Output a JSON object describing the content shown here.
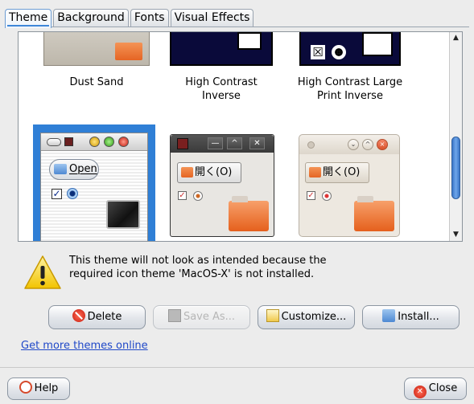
{
  "tabs": [
    {
      "label": "Theme",
      "active": true
    },
    {
      "label": "Background",
      "active": false
    },
    {
      "label": "Fonts",
      "active": false
    },
    {
      "label": "Visual Effects",
      "active": false
    }
  ],
  "themes": {
    "dust_sand": {
      "label": "Dust Sand"
    },
    "high_contrast_inverse": {
      "label_line1": "High Contrast",
      "label_line2": "Inverse"
    },
    "high_contrast_large_print_inverse": {
      "label_line1": "High Contrast Large",
      "label_line2": "Print Inverse",
      "check_glyph": "☒"
    },
    "selected": {
      "open_label": "Open",
      "check_glyph": "✓"
    },
    "dark": {
      "open_label": "開く(O)",
      "check_glyph": "✓",
      "min_glyph": "—",
      "max_glyph": "^",
      "close_glyph": "✕"
    },
    "light": {
      "open_label": "開く(O)",
      "check_glyph": "✓",
      "min_glyph": "⌄",
      "max_glyph": "^",
      "close_glyph": "×"
    }
  },
  "warning": {
    "icon": "warning-icon",
    "text": "This theme will not look as intended because the required icon theme 'MacOS-X' is not installed."
  },
  "buttons": {
    "delete": "Delete",
    "save_as": "Save As...",
    "customize": "Customize...",
    "install": "Install...",
    "help": "Help",
    "close": "Close"
  },
  "link": {
    "more_themes": "Get more themes online"
  },
  "scrollbar": {
    "up_glyph": "▲",
    "down_glyph": "▼"
  },
  "colors": {
    "accent": "#2f7fd6",
    "link": "#1f48c8"
  }
}
